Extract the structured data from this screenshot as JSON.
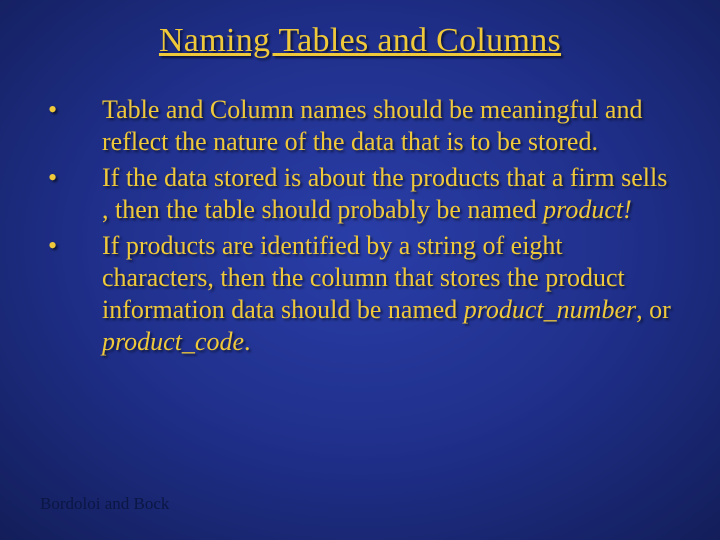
{
  "slide": {
    "title": "Naming Tables and Columns",
    "bullets": [
      {
        "text": "Table and Column names should be meaningful and reflect the nature of the data that is to be stored."
      },
      {
        "text_pre": "If the data stored is about the products that a firm sells , then the table should probably be named ",
        "emph": "product!"
      },
      {
        "text_pre": "If products are identified by a string of eight characters, then the column that stores the product information data should be named ",
        "emph": "product_number",
        "text_mid": ", or ",
        "emph2": "product_code",
        "text_post": "."
      }
    ],
    "footer": "Bordoloi and Bock"
  }
}
